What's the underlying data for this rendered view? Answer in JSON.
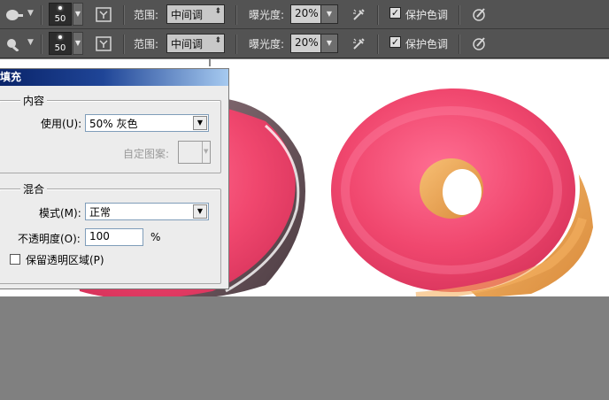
{
  "toolbar_rows": [
    {
      "brush_size": "50",
      "range_label": "范围:",
      "range_value": "中间调",
      "exposure_label": "曝光度:",
      "exposure_value": "20%",
      "protect_label": "保护色调",
      "protect_checked": "✓"
    },
    {
      "brush_size": "50",
      "range_label": "范围:",
      "range_value": "中间调",
      "exposure_label": "曝光度:",
      "exposure_value": "20%",
      "protect_label": "保护色调",
      "protect_checked": "✓"
    }
  ],
  "dialog": {
    "title": "填充",
    "content_group": "内容",
    "use_label": "使用(U):",
    "use_value": "50% 灰色",
    "custom_pattern_label": "自定图案:",
    "blend_group": "混合",
    "mode_label": "模式(M):",
    "mode_value": "正常",
    "opacity_label": "不透明度(O):",
    "opacity_value": "100",
    "opacity_unit": "%",
    "preserve_label": "保留透明区域(P)"
  },
  "colors": {
    "optionbar": "#535353",
    "canvas": "#ffffff",
    "workspace": "#808080",
    "frosting": "#f0476e",
    "dough": "#f0a04e",
    "chocolate": "#5e4a52"
  }
}
